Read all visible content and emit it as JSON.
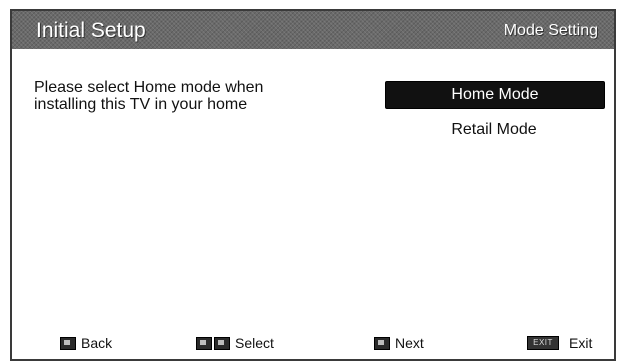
{
  "header": {
    "title": "Initial Setup",
    "section": "Mode Setting"
  },
  "main": {
    "instruction": "Please select Home mode when\ninstalling this TV in your home",
    "options": [
      {
        "label": "Home Mode",
        "selected": true
      },
      {
        "label": "Retail Mode",
        "selected": false
      }
    ]
  },
  "footer": {
    "back_label": "Back",
    "select_label": "Select",
    "next_label": "Next",
    "exit_key": "EXIT",
    "exit_label": "Exit"
  },
  "colors": {
    "header_bg": "#6a6a6a",
    "selected_bg": "#111111",
    "text": "#111111"
  }
}
